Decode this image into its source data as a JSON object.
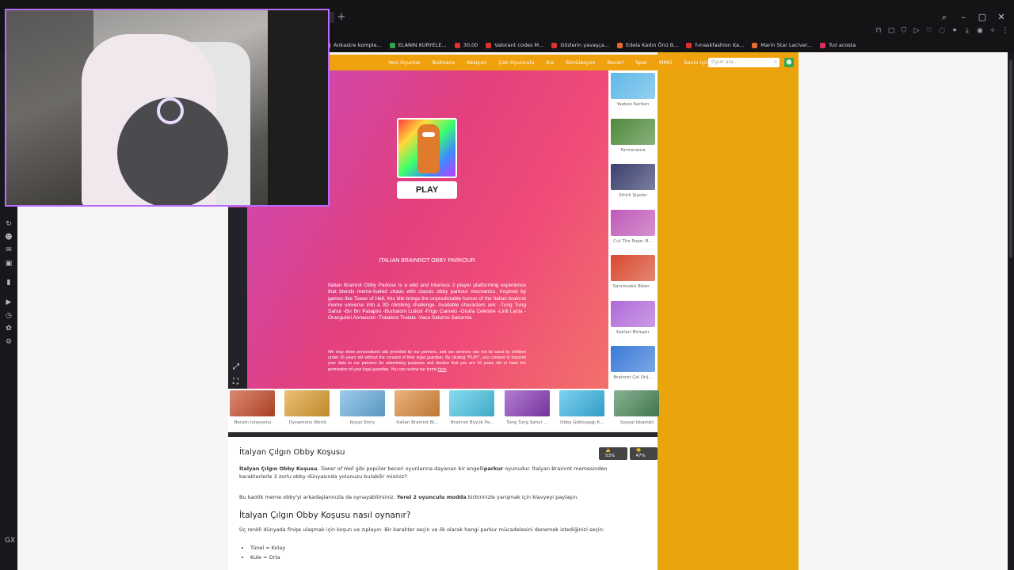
{
  "browser": {
    "new_tab_symbol": "+",
    "window_controls": [
      "⌕",
      "–",
      "▢",
      "✕"
    ],
    "bookmarks": [
      {
        "label": "Ankastre komple...",
        "color": "#e0a030"
      },
      {
        "label": "ELANIN KURYELE...",
        "color": "#2ea84f"
      },
      {
        "label": "30,00",
        "color": "#e03030"
      },
      {
        "label": "Valorant codes M...",
        "color": "#e03030"
      },
      {
        "label": "Gözlerin yavaşça...",
        "color": "#e03030"
      },
      {
        "label": "Edela Kadın Önü B...",
        "color": "#e86a2a"
      },
      {
        "label": "f-maskfashion Ka...",
        "color": "#e03030"
      },
      {
        "label": "Marin Star Laciver...",
        "color": "#e86a2a"
      },
      {
        "label": "Tuıl acosta",
        "color": "#e03060"
      }
    ]
  },
  "nav": {
    "links": [
      "Yeni Oyunlar",
      "Bulmaca",
      "Aksiyon",
      "Çok Oyunculu",
      "Kız",
      "Simülasyon",
      "Beceri",
      "Spor",
      "MMO",
      "Senin için"
    ],
    "search_placeholder": "Oyun ara..."
  },
  "game": {
    "play_label": "PLAY",
    "title": "ITALIAN BRAINROT OBBY PARKOUR",
    "description": "Italian Brainrot Obby Parkour is a wild and hilarious 2 player platforming experience that blends meme-fueled chaos with classic obby parkour mechanics. Inspired by games like Tower of Hell, this title brings the unpredictable humor of the Italian brainrot meme universe into a 3D climbing challenge. Available characters are: -Tung Tung Sahur -Brr Brr Patapim -Burbaloni Luliloli -Frigo Camelo -Girafa Celestre -Lirili Larila -Orangutini Annaucini -Tralalero Tralala -Vaca Saturno Saturnita",
    "notice": "We may show personalized ads provided by our partners, and our services can not be used by children under 16 years old without the consent of their legal guardian. By clicking \"PLAY\", you consent to transmit your data to our partners for advertising purposes and declare that you are 16 years old or have the permission of your legal guardian. You can review our terms",
    "notice_link": "here",
    "notice_end": "."
  },
  "side_games": [
    {
      "label": "Yapboz Kartları",
      "color": "#5fb8e8"
    },
    {
      "label": "Farmerama",
      "color": "#4f8a3a"
    },
    {
      "label": "Sihirli Şişeler",
      "color": "#3a3f6e"
    },
    {
      "label": "Cut The Rope: B...",
      "color": "#c05ab8"
    },
    {
      "label": "Sanımsaklı Biber...",
      "color": "#d8492f"
    },
    {
      "label": "Kekleri Birleştir",
      "color": "#b06ad8"
    },
    {
      "label": "Brainrot Çal Orij...",
      "color": "#3a7ad8"
    }
  ],
  "bottom_games": [
    {
      "label": "Benzin İstasyonu",
      "color": "#c84a2a"
    },
    {
      "label": "Dynamons World",
      "color": "#e0a030"
    },
    {
      "label": "Royal Story",
      "color": "#6ab0e0"
    },
    {
      "label": "Italian Brainrot Bi...",
      "color": "#e08a3a"
    },
    {
      "label": "Brainrot Büyük Pa...",
      "color": "#4ac8e8"
    },
    {
      "label": "Tung Tung Sahur ...",
      "color": "#8a3ab8"
    },
    {
      "label": "Obby Gökkuşağı K...",
      "color": "#3ab8e8"
    },
    {
      "label": "Sosyal İskambil",
      "color": "#4a8a5a"
    }
  ],
  "article": {
    "title": "İtalyan Çılgın Obby Koşusu",
    "vote_up": "53%",
    "vote_down": "47%",
    "p1_bold": "İtalyan Çılgın Obby Koşusu",
    "p1_a": ", ",
    "p1_italic": "Tower of Hell",
    "p1_b": " gibi popüler beceri oyunlarına dayanan bir engelli",
    "p1_bold2": "parkur",
    "p1_c": " oyunudur. İtalyan Brainrot memesinden karakterlerle 3 zorlu obby dünyasında yolunuzu bulabilir misiniz?",
    "p2_a": "Bu kaotik meme obby'yi arkadaşlarınızla da oynayabilirsiniz. ",
    "p2_bold": "Yerel 2 oyunculu modda",
    "p2_b": " birbirinizle yarışmak için klavyeyi paylaşın.",
    "h2": "İtalyan Çılgın Obby Koşusu nasıl oynanır?",
    "p3": "Üç renkli dünyada finişe ulaşmak için koşun ve zıplayın. Bir karakter seçin ve ilk olarak hangi parkur mücadelesini denemek istediğinizi seçin:",
    "list": [
      "Tünel = Kolay",
      "Kule = Orta"
    ]
  }
}
